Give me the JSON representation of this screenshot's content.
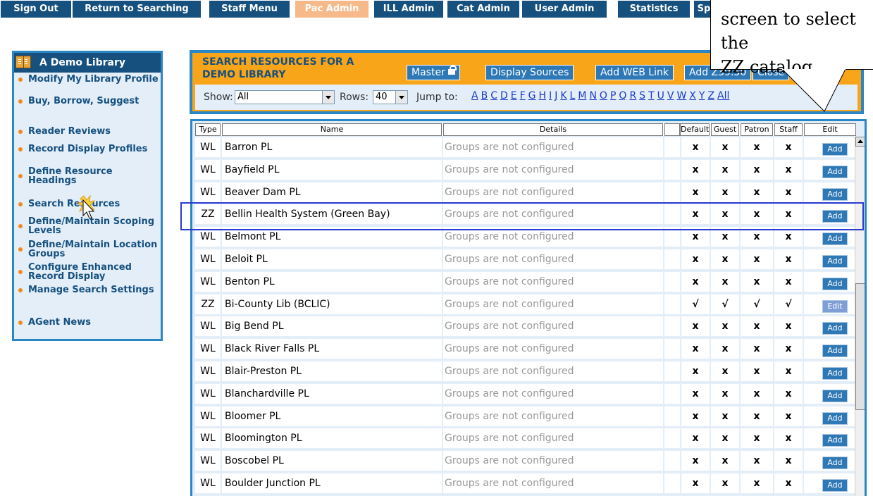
{
  "nav": {
    "items": [
      {
        "label": "Sign Out"
      },
      {
        "label": "Return to Searching"
      },
      {
        "label": "Staff Menu"
      },
      {
        "label": "Pac Admin"
      },
      {
        "label": "ILL Admin"
      },
      {
        "label": "Cat Admin"
      },
      {
        "label": "User Admin"
      },
      {
        "label": "Statistics"
      },
      {
        "label": "Sp"
      }
    ],
    "active_color": "#f7b98a",
    "color": "#16507f"
  },
  "sidebar": {
    "title": "A Demo Library",
    "items": [
      {
        "label": "Modify My Library Profile"
      },
      {
        "label": "Buy, Borrow, Suggest"
      },
      {
        "label": "Reader Reviews"
      },
      {
        "label": "Record Display Profiles"
      },
      {
        "label": "Define Resource Headings"
      },
      {
        "label": "Search Resources"
      },
      {
        "label": "Define/Maintain Scoping Levels"
      },
      {
        "label": "Define/Maintain Location Groups"
      },
      {
        "label": "Configure Enhanced Record Display"
      },
      {
        "label": "Manage Search Settings"
      },
      {
        "label": "AGent News"
      }
    ]
  },
  "panel": {
    "title": "SEARCH RESOURCES FOR A DEMO LIBRARY",
    "buttons": {
      "master": "Master",
      "display_sources": "Display Sources",
      "add_web_link": "Add WEB Link",
      "add_z3950": "Add Z39.50",
      "close": "Close"
    },
    "show_label": "Show:",
    "show_value": "All",
    "rows_label": "Rows:",
    "rows_value": "40",
    "jump_label": "Jump to:",
    "letters": [
      "A",
      "B",
      "C",
      "D",
      "E",
      "F",
      "G",
      "H",
      "I",
      "J",
      "K",
      "L",
      "M",
      "N",
      "O",
      "P",
      "Q",
      "R",
      "S",
      "T",
      "U",
      "V",
      "W",
      "X",
      "Y",
      "Z",
      "All"
    ]
  },
  "callout": {
    "text": "screen to select the\nZZ catalog"
  },
  "table": {
    "headers": {
      "type": "Type",
      "name": "Name",
      "details": "Details",
      "default": "Default",
      "guest": "Guest",
      "patron": "Patron",
      "staff": "Staff",
      "edit": "Edit"
    },
    "rows": [
      {
        "type": "WL",
        "name": "Barron PL",
        "details": "Groups are not configured",
        "default": "x",
        "guest": "x",
        "patron": "x",
        "staff": "x",
        "action": "Add"
      },
      {
        "type": "WL",
        "name": "Bayfield PL",
        "details": "Groups are not configured",
        "default": "x",
        "guest": "x",
        "patron": "x",
        "staff": "x",
        "action": "Add"
      },
      {
        "type": "WL",
        "name": "Beaver Dam PL",
        "details": "Groups are not configured",
        "default": "x",
        "guest": "x",
        "patron": "x",
        "staff": "x",
        "action": "Add"
      },
      {
        "type": "ZZ",
        "name": "Bellin Health System (Green Bay)",
        "details": "Groups are not configured",
        "default": "x",
        "guest": "x",
        "patron": "x",
        "staff": "x",
        "action": "Add"
      },
      {
        "type": "WL",
        "name": "Belmont PL",
        "details": "Groups are not configured",
        "default": "x",
        "guest": "x",
        "patron": "x",
        "staff": "x",
        "action": "Add"
      },
      {
        "type": "WL",
        "name": "Beloit PL",
        "details": "Groups are not configured",
        "default": "x",
        "guest": "x",
        "patron": "x",
        "staff": "x",
        "action": "Add"
      },
      {
        "type": "WL",
        "name": "Benton PL",
        "details": "Groups are not configured",
        "default": "x",
        "guest": "x",
        "patron": "x",
        "staff": "x",
        "action": "Add"
      },
      {
        "type": "ZZ",
        "name": "Bi-County Lib (BCLIC)",
        "details": "Groups are not configured",
        "default": "√",
        "guest": "√",
        "patron": "√",
        "staff": "√",
        "action": "Edit"
      },
      {
        "type": "WL",
        "name": "Big Bend PL",
        "details": "Groups are not configured",
        "default": "x",
        "guest": "x",
        "patron": "x",
        "staff": "x",
        "action": "Add"
      },
      {
        "type": "WL",
        "name": "Black River Falls PL",
        "details": "Groups are not configured",
        "default": "x",
        "guest": "x",
        "patron": "x",
        "staff": "x",
        "action": "Add"
      },
      {
        "type": "WL",
        "name": "Blair-Preston PL",
        "details": "Groups are not configured",
        "default": "x",
        "guest": "x",
        "patron": "x",
        "staff": "x",
        "action": "Add"
      },
      {
        "type": "WL",
        "name": "Blanchardville PL",
        "details": "Groups are not configured",
        "default": "x",
        "guest": "x",
        "patron": "x",
        "staff": "x",
        "action": "Add"
      },
      {
        "type": "WL",
        "name": "Bloomer PL",
        "details": "Groups are not configured",
        "default": "x",
        "guest": "x",
        "patron": "x",
        "staff": "x",
        "action": "Add"
      },
      {
        "type": "WL",
        "name": "Bloomington PL",
        "details": "Groups are not configured",
        "default": "x",
        "guest": "x",
        "patron": "x",
        "staff": "x",
        "action": "Add"
      },
      {
        "type": "WL",
        "name": "Boscobel PL",
        "details": "Groups are not configured",
        "default": "x",
        "guest": "x",
        "patron": "x",
        "staff": "x",
        "action": "Add"
      },
      {
        "type": "WL",
        "name": "Boulder Junction PL",
        "details": "Groups are not configured",
        "default": "x",
        "guest": "x",
        "patron": "x",
        "staff": "x",
        "action": "Add"
      }
    ]
  }
}
